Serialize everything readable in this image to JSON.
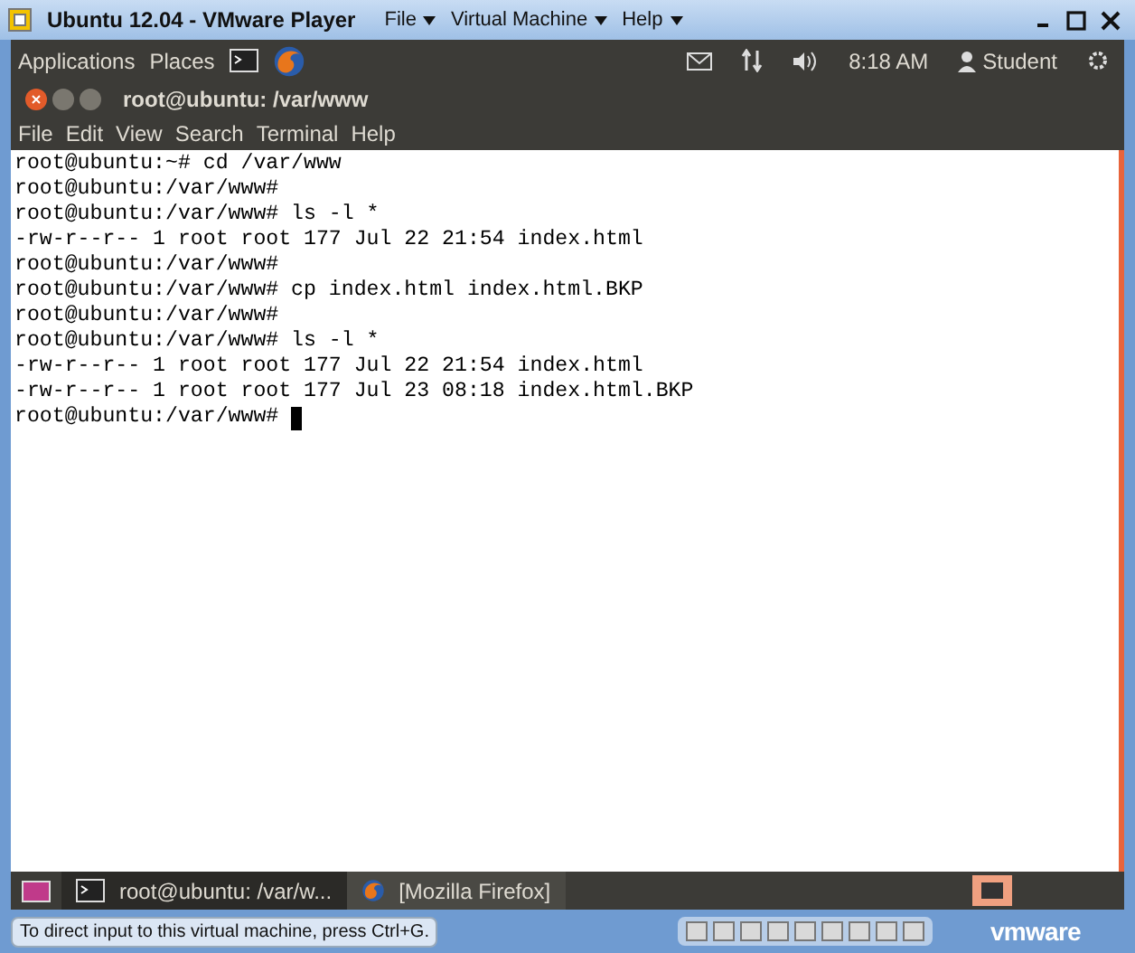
{
  "player_window": {
    "title": "Ubuntu 12.04 - VMware Player",
    "menus": [
      "File",
      "Virtual Machine",
      "Help"
    ]
  },
  "top_panel": {
    "menus": [
      "Applications",
      "Places"
    ],
    "clock": "8:18 AM",
    "user": "Student"
  },
  "terminal": {
    "title": "root@ubuntu: /var/www",
    "menus": [
      "File",
      "Edit",
      "View",
      "Search",
      "Terminal",
      "Help"
    ],
    "lines": [
      "root@ubuntu:~# cd /var/www",
      "root@ubuntu:/var/www#",
      "root@ubuntu:/var/www# ls -l *",
      "-rw-r--r-- 1 root root 177 Jul 22 21:54 index.html",
      "root@ubuntu:/var/www#",
      "root@ubuntu:/var/www# cp index.html index.html.BKP",
      "root@ubuntu:/var/www#",
      "root@ubuntu:/var/www# ls -l *",
      "-rw-r--r-- 1 root root 177 Jul 22 21:54 index.html",
      "-rw-r--r-- 1 root root 177 Jul 23 08:18 index.html.BKP",
      "root@ubuntu:/var/www# "
    ]
  },
  "taskbar": [
    {
      "kind": "terminal",
      "label": "root@ubuntu: /var/w...",
      "selected": true
    },
    {
      "kind": "browser",
      "label": "[Mozilla Firefox]",
      "selected": false
    }
  ],
  "status_bar": {
    "message": "To direct input to this virtual machine, press Ctrl+G.",
    "brand": "vmware"
  }
}
